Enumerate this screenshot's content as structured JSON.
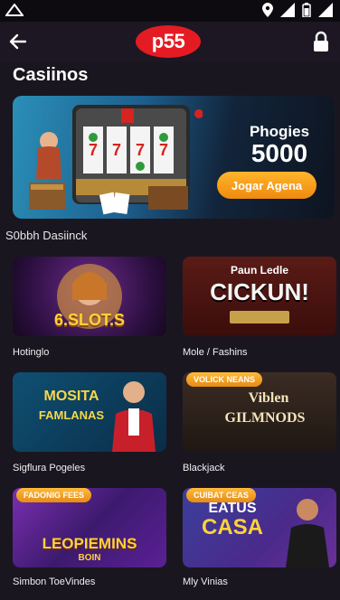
{
  "status_bar": {
    "left_icon": "warning-triangle-icon",
    "right_icons": [
      "location-icon",
      "signal-icon",
      "battery-icon",
      "wifi-icon"
    ]
  },
  "header": {
    "logo_text": "p55",
    "back_icon": "arrow-left-icon",
    "lock_icon": "lock-icon"
  },
  "main": {
    "section_title": "Casiinos",
    "hero": {
      "subtitle": "Phogies",
      "amount": "5000",
      "button_label": "Jogar Agena"
    },
    "sub_section_title": "S0bbh Dasiinck",
    "cards": [
      {
        "label": "Hotinglo",
        "art_text": "6.SLOT.S",
        "art_subtext": "",
        "badge": ""
      },
      {
        "label": "Mole / Fashins",
        "art_text": "CICKUN!",
        "art_subtext": "Paun Ledle",
        "badge": ""
      },
      {
        "label": "Sigflura Pogeles",
        "art_text": "MOSITA",
        "art_subtext": "FAMLANAS",
        "badge": ""
      },
      {
        "label": "Blackjack",
        "art_text": "GILMNODS",
        "art_subtext": "Viblen",
        "badge": "VOLICK NEANS"
      },
      {
        "label": "Simbon ToeVindes",
        "art_text": "LEOPIEMINS",
        "art_subtext": "BOIN",
        "badge": "FADONIG FEES"
      },
      {
        "label": "Mly Vinias",
        "art_text": "CASA",
        "art_subtext": "EATUS",
        "badge": "CUIBAT CEAS"
      }
    ]
  },
  "colors": {
    "background": "#1a1620",
    "logo_red": "#e51b23",
    "accent_orange": "#f59a1a"
  }
}
